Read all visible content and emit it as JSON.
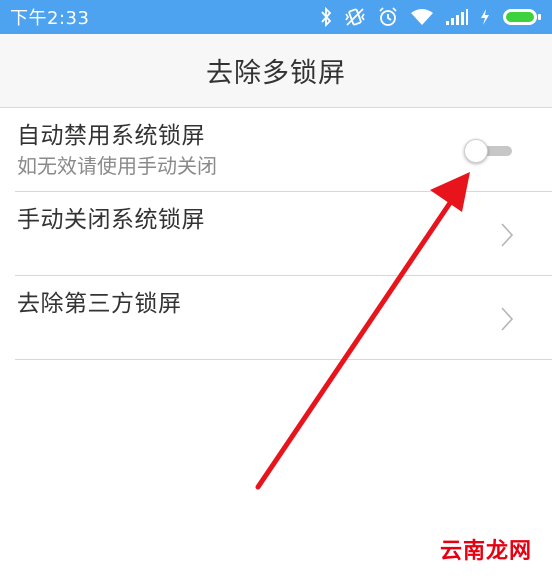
{
  "status_bar": {
    "time": "下午2:33",
    "icons": [
      "bluetooth-icon",
      "vibrate-icon",
      "alarm-icon",
      "wifi-icon",
      "signal-icon",
      "charging-icon",
      "battery-icon"
    ],
    "color": "#4da3f0"
  },
  "header": {
    "title": "去除多锁屏"
  },
  "list": {
    "items": [
      {
        "title": "自动禁用系统锁屏",
        "subtitle": "如无效请使用手动关闭",
        "control": "toggle",
        "toggle_on": false
      },
      {
        "title": "手动关闭系统锁屏",
        "control": "chevron"
      },
      {
        "title": "去除第三方锁屏",
        "control": "chevron"
      }
    ]
  },
  "annotation": {
    "arrow_color": "#e8141c"
  },
  "watermark": {
    "text": "云南龙网"
  }
}
